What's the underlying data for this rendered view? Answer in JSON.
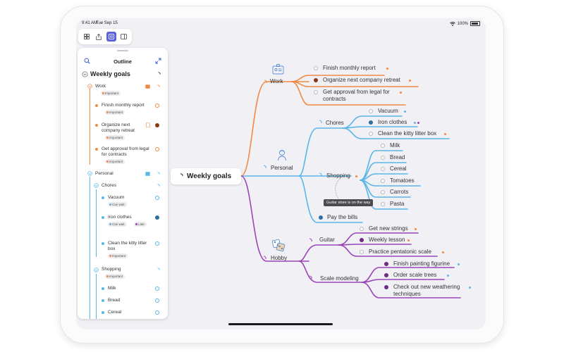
{
  "status": {
    "time": "9:41 AM",
    "date": "Tue Sep 15",
    "battery": "100%"
  },
  "toolbar": {
    "icons": [
      "grid-icon",
      "share-icon",
      "outline-icon",
      "sidebar-icon"
    ]
  },
  "outline": {
    "title": "Outline",
    "root": "Weekly goals",
    "work": {
      "label": "Work",
      "tag": "Important"
    },
    "work_items": [
      {
        "label": "Finish monthly report",
        "tag": "Important",
        "done": false
      },
      {
        "label": "Organize next company retreat",
        "tag": "Important",
        "done": true
      },
      {
        "label": "Get approval from legal for contracts",
        "tag": "Important",
        "done": false
      }
    ],
    "personal": {
      "label": "Personal"
    },
    "chores": {
      "label": "Chores"
    },
    "chores_items": [
      {
        "label": "Vacuum",
        "tags": [
          "Can wait"
        ],
        "done": false
      },
      {
        "label": "Iron clothes",
        "tags": [
          "Can wait",
          "Late"
        ],
        "done": true
      },
      {
        "label": "Clean the kitty litter box",
        "tags": [
          "Important"
        ],
        "done": false
      }
    ],
    "shopping": {
      "label": "Shopping",
      "tag": "Important"
    },
    "shopping_items": [
      "Milk",
      "Bread",
      "Cereal"
    ]
  },
  "map": {
    "central": "Weekly goals",
    "work": {
      "label": "Work",
      "items": [
        "Finish monthly report",
        "Organize next company retreat",
        "Get approval from legal for contracts"
      ]
    },
    "personal": {
      "label": "Personal",
      "chores": {
        "label": "Chores",
        "items": [
          "Vacuum",
          "Iron clothes",
          "Clean the kitty litter box"
        ]
      },
      "shopping": {
        "label": "Shopping",
        "items": [
          "Milk",
          "Bread",
          "Cereal",
          "Tomatoes",
          "Carrots",
          "Pasta"
        ]
      },
      "bills": "Pay the bills"
    },
    "hobby": {
      "label": "Hobby",
      "guitar": {
        "label": "Guitar",
        "items": [
          "Get new strings",
          "Weekly lesson",
          "Practice pentatonic scale"
        ]
      },
      "scale": {
        "label": "Scale modeling",
        "items": [
          "Finish painting figurine",
          "Order scale trees",
          "Check out new weathering techniques"
        ]
      }
    },
    "tooltip": "Guitar store is on the way"
  },
  "colors": {
    "work": "#ef8a45",
    "personal": "#5bb6e8",
    "hobby": "#9b45b8",
    "important": "#ef8a45",
    "can_wait": "#5bb6e8",
    "late": "#9b45b8"
  }
}
